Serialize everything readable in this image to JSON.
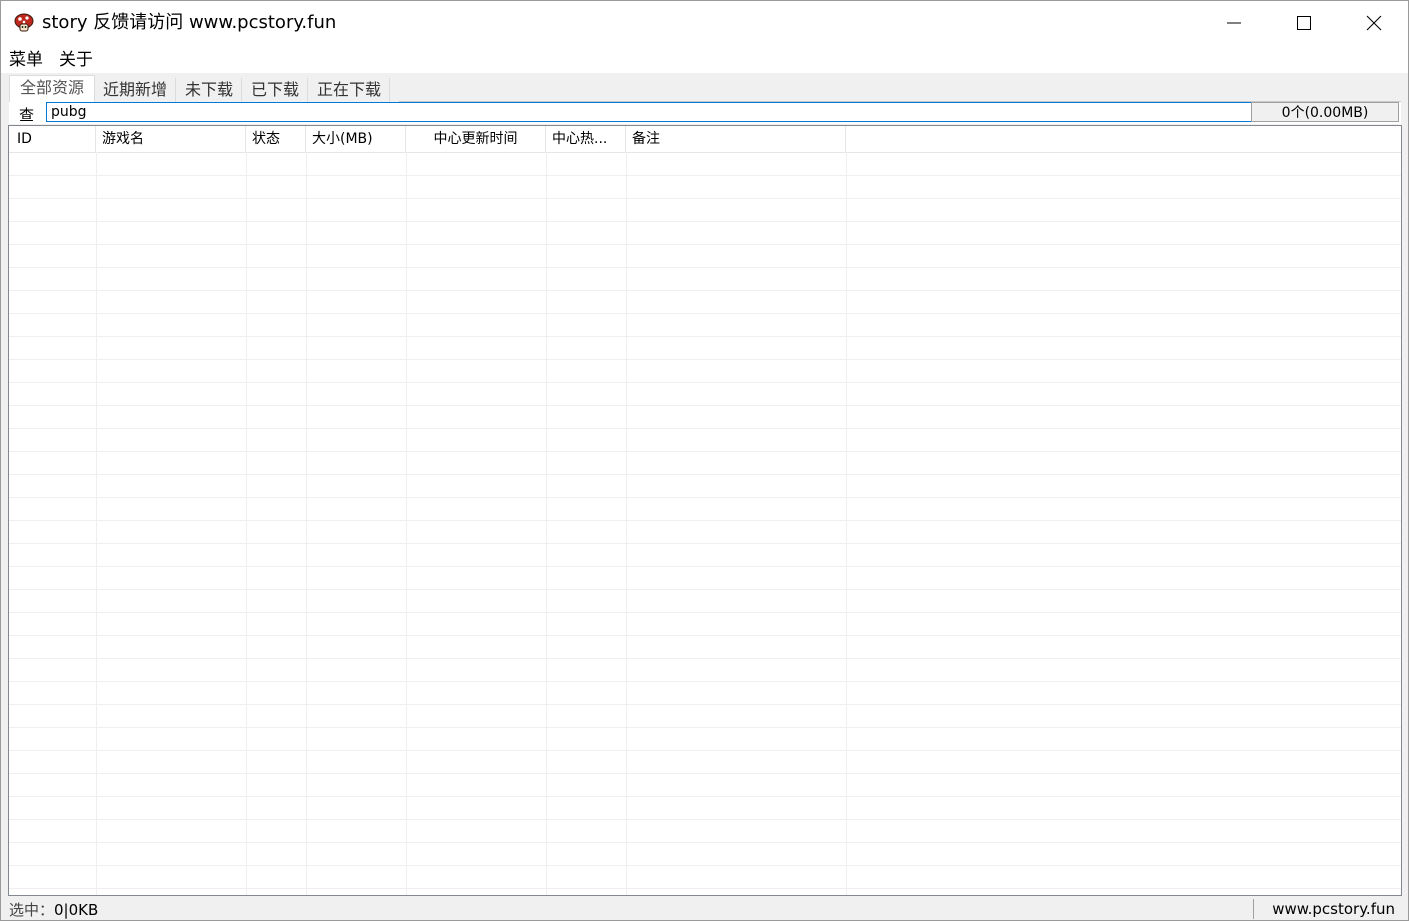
{
  "window": {
    "title": "story 反馈请访问 www.pcstory.fun",
    "icon": "mushroom-app-icon",
    "controls": [
      "minimize-icon",
      "maximize-icon",
      "close-icon"
    ]
  },
  "menu": {
    "items": [
      "菜单",
      "关于"
    ]
  },
  "tabs": {
    "items": [
      "全部资源",
      "近期新增",
      "未下载",
      "已下载",
      "正在下载"
    ],
    "active_index": 0
  },
  "search": {
    "label": "查",
    "value": "pubg",
    "count": "0个(0.00MB)"
  },
  "list": {
    "columns": [
      "ID",
      "游戏名",
      "状态",
      "大小(MB)",
      "中心更新时间",
      "中心热...",
      "备注"
    ],
    "rows": []
  },
  "status": {
    "selected_label": "选中：",
    "selected_value": "0|0KB",
    "website": "www.pcstory.fun"
  },
  "colors": {
    "focus_border": "#0078d7",
    "chrome_background": "#f0f0f0"
  }
}
